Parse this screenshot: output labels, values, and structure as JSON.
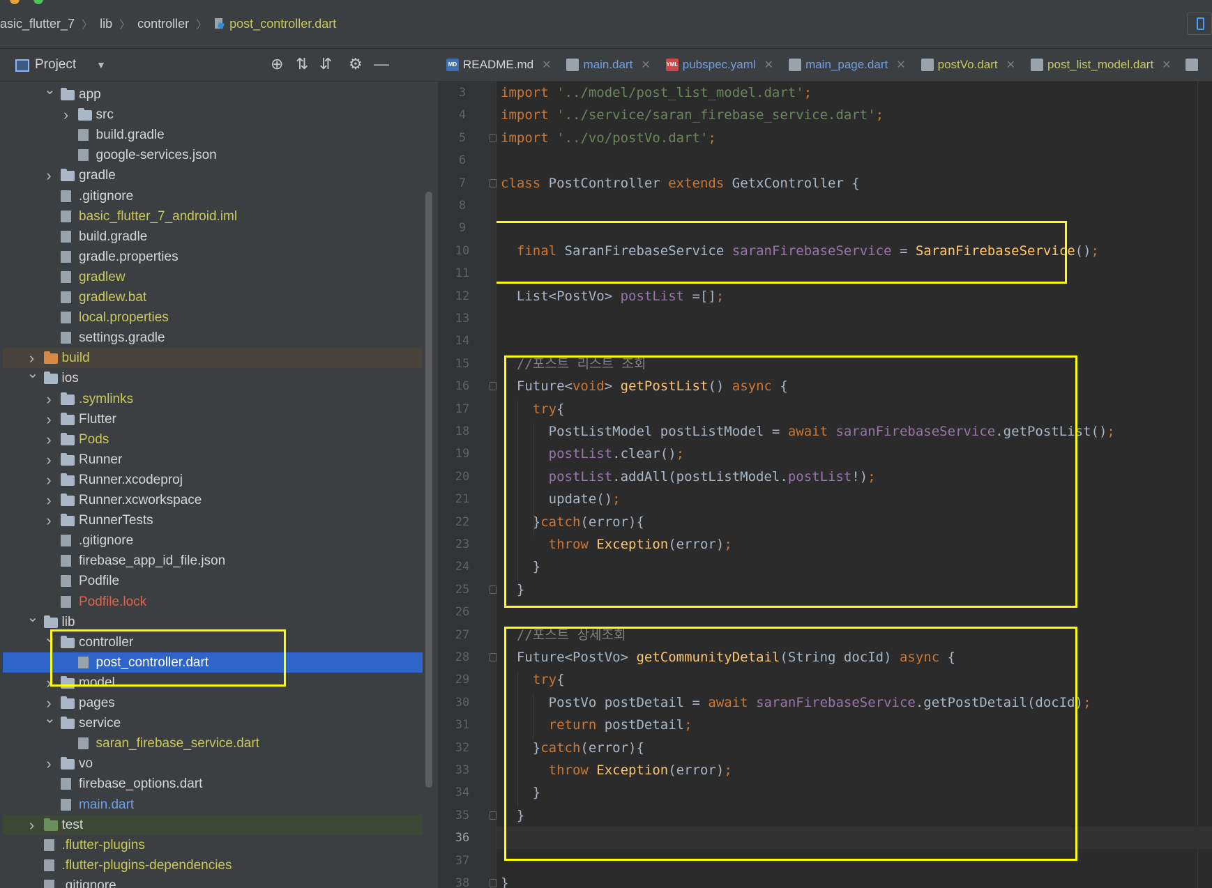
{
  "breadcrumb": {
    "project": "asic_flutter_7",
    "lib": "lib",
    "controller": "controller",
    "file": "post_controller.dart"
  },
  "project_panel": {
    "title": "Project",
    "tree": [
      {
        "label": "app",
        "type": "folder",
        "depth": 2,
        "expanded": true,
        "color": "white"
      },
      {
        "label": "src",
        "type": "folder",
        "depth": 3,
        "expanded": false,
        "color": "white"
      },
      {
        "label": "build.gradle",
        "type": "file",
        "depth": 3,
        "color": "white"
      },
      {
        "label": "google-services.json",
        "type": "file",
        "depth": 3,
        "color": "white"
      },
      {
        "label": "gradle",
        "type": "folder",
        "depth": 2,
        "expanded": false,
        "color": "white"
      },
      {
        "label": ".gitignore",
        "type": "file",
        "depth": 2,
        "color": "white"
      },
      {
        "label": "basic_flutter_7_android.iml",
        "type": "file",
        "depth": 2,
        "color": "yellow"
      },
      {
        "label": "build.gradle",
        "type": "file",
        "depth": 2,
        "color": "white"
      },
      {
        "label": "gradle.properties",
        "type": "file",
        "depth": 2,
        "color": "white"
      },
      {
        "label": "gradlew",
        "type": "file",
        "depth": 2,
        "color": "yellow"
      },
      {
        "label": "gradlew.bat",
        "type": "file",
        "depth": 2,
        "color": "yellow"
      },
      {
        "label": "local.properties",
        "type": "file",
        "depth": 2,
        "color": "yellow"
      },
      {
        "label": "settings.gradle",
        "type": "file",
        "depth": 2,
        "color": "white"
      },
      {
        "label": "build",
        "type": "folder-orange",
        "depth": 1,
        "expanded": false,
        "color": "yellow",
        "row": "excl"
      },
      {
        "label": "ios",
        "type": "folder",
        "depth": 1,
        "expanded": true,
        "color": "white"
      },
      {
        "label": ".symlinks",
        "type": "folder",
        "depth": 2,
        "expanded": false,
        "color": "yellow"
      },
      {
        "label": "Flutter",
        "type": "folder",
        "depth": 2,
        "expanded": false,
        "color": "white"
      },
      {
        "label": "Pods",
        "type": "folder",
        "depth": 2,
        "expanded": false,
        "color": "yellow"
      },
      {
        "label": "Runner",
        "type": "folder",
        "depth": 2,
        "expanded": false,
        "color": "white"
      },
      {
        "label": "Runner.xcodeproj",
        "type": "folder",
        "depth": 2,
        "expanded": false,
        "color": "white"
      },
      {
        "label": "Runner.xcworkspace",
        "type": "folder",
        "depth": 2,
        "expanded": false,
        "color": "white"
      },
      {
        "label": "RunnerTests",
        "type": "folder",
        "depth": 2,
        "expanded": false,
        "color": "white"
      },
      {
        "label": ".gitignore",
        "type": "file",
        "depth": 2,
        "color": "white"
      },
      {
        "label": "firebase_app_id_file.json",
        "type": "file",
        "depth": 2,
        "color": "white"
      },
      {
        "label": "Podfile",
        "type": "file",
        "depth": 2,
        "color": "white"
      },
      {
        "label": "Podfile.lock",
        "type": "file",
        "depth": 2,
        "color": "red"
      },
      {
        "label": "lib",
        "type": "folder",
        "depth": 1,
        "expanded": true,
        "color": "white"
      },
      {
        "label": "controller",
        "type": "folder",
        "depth": 2,
        "expanded": true,
        "color": "white"
      },
      {
        "label": "post_controller.dart",
        "type": "file",
        "depth": 3,
        "color": "white",
        "row": "sel"
      },
      {
        "label": "model",
        "type": "folder",
        "depth": 2,
        "expanded": false,
        "color": "white"
      },
      {
        "label": "pages",
        "type": "folder",
        "depth": 2,
        "expanded": false,
        "color": "white"
      },
      {
        "label": "service",
        "type": "folder",
        "depth": 2,
        "expanded": true,
        "color": "white"
      },
      {
        "label": "saran_firebase_service.dart",
        "type": "file",
        "depth": 3,
        "color": "green"
      },
      {
        "label": "vo",
        "type": "folder",
        "depth": 2,
        "expanded": false,
        "color": "white"
      },
      {
        "label": "firebase_options.dart",
        "type": "file",
        "depth": 2,
        "color": "white"
      },
      {
        "label": "main.dart",
        "type": "file",
        "depth": 2,
        "color": "blue"
      },
      {
        "label": "test",
        "type": "folder-green",
        "depth": 1,
        "expanded": false,
        "color": "white",
        "row": "testrow"
      },
      {
        "label": ".flutter-plugins",
        "type": "file",
        "depth": 1,
        "color": "yellow"
      },
      {
        "label": ".flutter-plugins-dependencies",
        "type": "file",
        "depth": 1,
        "color": "yellow"
      },
      {
        "label": ".gitignore",
        "type": "file",
        "depth": 1,
        "color": "white"
      }
    ]
  },
  "tabs": [
    {
      "label": "README.md",
      "icon": "MD",
      "color": "white"
    },
    {
      "label": "main.dart",
      "icon": "dart",
      "color": "blue"
    },
    {
      "label": "pubspec.yaml",
      "icon": "YML",
      "color": "blue"
    },
    {
      "label": "main_page.dart",
      "icon": "dart",
      "color": "blue"
    },
    {
      "label": "postVo.dart",
      "icon": "dart",
      "color": "yellow"
    },
    {
      "label": "post_list_model.dart",
      "icon": "dart",
      "color": "yellow"
    }
  ],
  "editor": {
    "first_line": 3,
    "current_line": 36,
    "lines": [
      [
        [
          "kw",
          "import "
        ],
        [
          "str",
          "'../model/post_list_model.dart'"
        ],
        [
          "kw",
          ";"
        ]
      ],
      [
        [
          "kw",
          "import "
        ],
        [
          "str",
          "'../service/saran_firebase_service.dart'"
        ],
        [
          "kw",
          ";"
        ]
      ],
      [
        [
          "kw",
          "import "
        ],
        [
          "str",
          "'../vo/postVo.dart'"
        ],
        [
          "kw",
          ";"
        ]
      ],
      [],
      [
        [
          "kw",
          "class "
        ],
        [
          "txt",
          "PostController "
        ],
        [
          "kw",
          "extends "
        ],
        [
          "txt",
          "GetxController {"
        ]
      ],
      [],
      [],
      [
        [
          "txt",
          "  "
        ],
        [
          "kw",
          "final "
        ],
        [
          "txt",
          "SaranFirebaseService "
        ],
        [
          "fld",
          "saranFirebaseService"
        ],
        [
          "txt",
          " = "
        ],
        [
          "fn",
          "SaranFirebaseService"
        ],
        [
          "txt",
          "()"
        ],
        [
          "kw",
          ";"
        ]
      ],
      [],
      [
        [
          "txt",
          "  List<PostVo> "
        ],
        [
          "fld",
          "postList"
        ],
        [
          "txt",
          " =[]"
        ],
        [
          "kw",
          ";"
        ]
      ],
      [],
      [],
      [
        [
          "txt",
          "  "
        ],
        [
          "cm",
          "//포스트 리스트 조회"
        ]
      ],
      [
        [
          "txt",
          "  Future<"
        ],
        [
          "kw",
          "void"
        ],
        [
          "txt",
          "> "
        ],
        [
          "fn",
          "getPostList"
        ],
        [
          "txt",
          "() "
        ],
        [
          "kw",
          "async "
        ],
        [
          "txt",
          "{"
        ]
      ],
      [
        [
          "txt",
          "    "
        ],
        [
          "kw",
          "try"
        ],
        [
          "txt",
          "{"
        ]
      ],
      [
        [
          "txt",
          "      PostListModel postListModel = "
        ],
        [
          "kw",
          "await "
        ],
        [
          "fld",
          "saranFirebaseService"
        ],
        [
          "txt",
          ".getPostList()"
        ],
        [
          "kw",
          ";"
        ]
      ],
      [
        [
          "txt",
          "      "
        ],
        [
          "fld",
          "postList"
        ],
        [
          "txt",
          ".clear()"
        ],
        [
          "kw",
          ";"
        ]
      ],
      [
        [
          "txt",
          "      "
        ],
        [
          "fld",
          "postList"
        ],
        [
          "txt",
          ".addAll(postListModel."
        ],
        [
          "fld",
          "postList"
        ],
        [
          "txt",
          "!)"
        ],
        [
          "kw",
          ";"
        ]
      ],
      [
        [
          "txt",
          "      update()"
        ],
        [
          "kw",
          ";"
        ]
      ],
      [
        [
          "txt",
          "    }"
        ],
        [
          "kw",
          "catch"
        ],
        [
          "txt",
          "(error){"
        ]
      ],
      [
        [
          "txt",
          "      "
        ],
        [
          "kw",
          "throw "
        ],
        [
          "fn",
          "Exception"
        ],
        [
          "txt",
          "(error)"
        ],
        [
          "kw",
          ";"
        ]
      ],
      [
        [
          "txt",
          "    }"
        ]
      ],
      [
        [
          "txt",
          "  }"
        ]
      ],
      [],
      [
        [
          "txt",
          "  "
        ],
        [
          "cm",
          "//포스트 상세조회"
        ]
      ],
      [
        [
          "txt",
          "  Future<PostVo> "
        ],
        [
          "fn",
          "getCommunityDetail"
        ],
        [
          "txt",
          "(String docId) "
        ],
        [
          "kw",
          "async "
        ],
        [
          "txt",
          "{"
        ]
      ],
      [
        [
          "txt",
          "    "
        ],
        [
          "kw",
          "try"
        ],
        [
          "txt",
          "{"
        ]
      ],
      [
        [
          "txt",
          "      PostVo postDetail = "
        ],
        [
          "kw",
          "await "
        ],
        [
          "fld",
          "saranFirebaseService"
        ],
        [
          "txt",
          ".getPostDetail(docId)"
        ],
        [
          "kw",
          ";"
        ]
      ],
      [
        [
          "txt",
          "      "
        ],
        [
          "kw",
          "return "
        ],
        [
          "txt",
          "postDetail"
        ],
        [
          "kw",
          ";"
        ]
      ],
      [
        [
          "txt",
          "    }"
        ],
        [
          "kw",
          "catch"
        ],
        [
          "txt",
          "(error){"
        ]
      ],
      [
        [
          "txt",
          "      "
        ],
        [
          "kw",
          "throw "
        ],
        [
          "fn",
          "Exception"
        ],
        [
          "txt",
          "(error)"
        ],
        [
          "kw",
          ";"
        ]
      ],
      [
        [
          "txt",
          "    }"
        ]
      ],
      [
        [
          "txt",
          "  }"
        ]
      ],
      [],
      [],
      [
        [
          "txt",
          "}"
        ]
      ],
      []
    ]
  },
  "colors": {
    "highlight": "#ffff00",
    "selection": "#2f65ca",
    "keyword": "#cc7832",
    "string": "#6a8759",
    "function": "#ffc66d",
    "field": "#9876aa",
    "comment": "#808080"
  }
}
